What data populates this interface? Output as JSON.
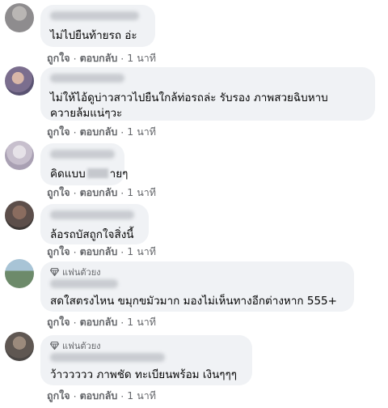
{
  "comments": [
    {
      "text": "ไม่ไปยืนท้ายรถ อ่ะ",
      "like": "ถูกใจ",
      "reply": "ตอบกลับ",
      "time": "1 นาที"
    },
    {
      "text": "ไม่ให้ไอ้ดูบ่าวสาวไปยืนใกล้ท่อรถล่ะ รับรอง ภาพสวยฉิบหาบ",
      "text2": "ควายล้มแน่ๆวะ",
      "like": "ถูกใจ",
      "reply": "ตอบกลับ",
      "time": "1 นาที"
    },
    {
      "text_pre": "คิดแบบ",
      "text_post": "ายๆ",
      "like": "ถูกใจ",
      "reply": "ตอบกลับ",
      "time": "1 นาที"
    },
    {
      "text": "ล้อรถบัสถูกใจสิ่งนี้",
      "like": "ถูกใจ",
      "reply": "ตอบกลับ",
      "time": "1 นาที"
    },
    {
      "badge": "แฟนตัวยง",
      "text": "สดใสตรงไหน ขมุกขมัวมาก มองไม่เห็นทางอีกต่างหาก 555+",
      "like": "ถูกใจ",
      "reply": "ตอบกลับ",
      "time": "1 นาที"
    },
    {
      "badge": "แฟนตัวยง",
      "text": "ว้าววววว ภาพชัด ทะเบียนพร้อม เงินๆๆๆ",
      "like": "ถูกใจ",
      "reply": "ตอบกลับ",
      "time": "1 นาที"
    }
  ],
  "separator": "·",
  "colors": {
    "bubble": "#f0f2f5",
    "meta_text": "#65676b",
    "body_text": "#050505"
  }
}
